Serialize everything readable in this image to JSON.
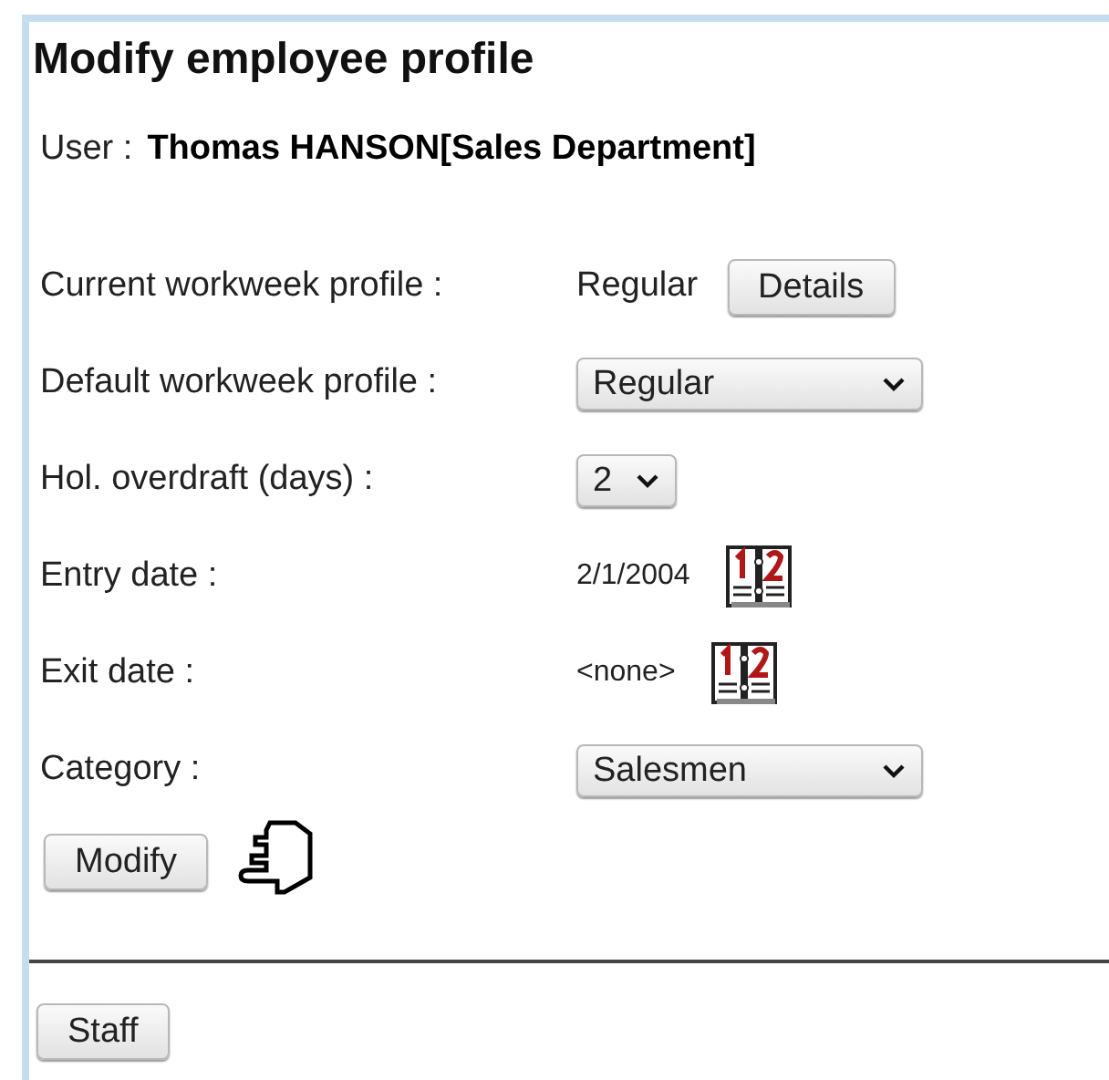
{
  "title": "Modify employee profile",
  "user": {
    "label": "User :",
    "value": "Thomas HANSON[Sales Department]"
  },
  "fields": [
    {
      "label": "Current workweek profile :",
      "kind": "text",
      "value": "Regular",
      "button": "Details"
    },
    {
      "label": "Default workweek profile :",
      "kind": "select",
      "value": "Regular"
    },
    {
      "label": "Hol. overdraft (days) :",
      "kind": "select",
      "value": "2"
    },
    {
      "label": "Entry date :",
      "kind": "date",
      "value": "2/1/2004"
    },
    {
      "label": "Exit date :",
      "kind": "date",
      "value": "<none>"
    },
    {
      "label": "Category :",
      "kind": "select",
      "value": "Salesmen"
    }
  ],
  "submit": "Modify",
  "footer_button": "Staff"
}
